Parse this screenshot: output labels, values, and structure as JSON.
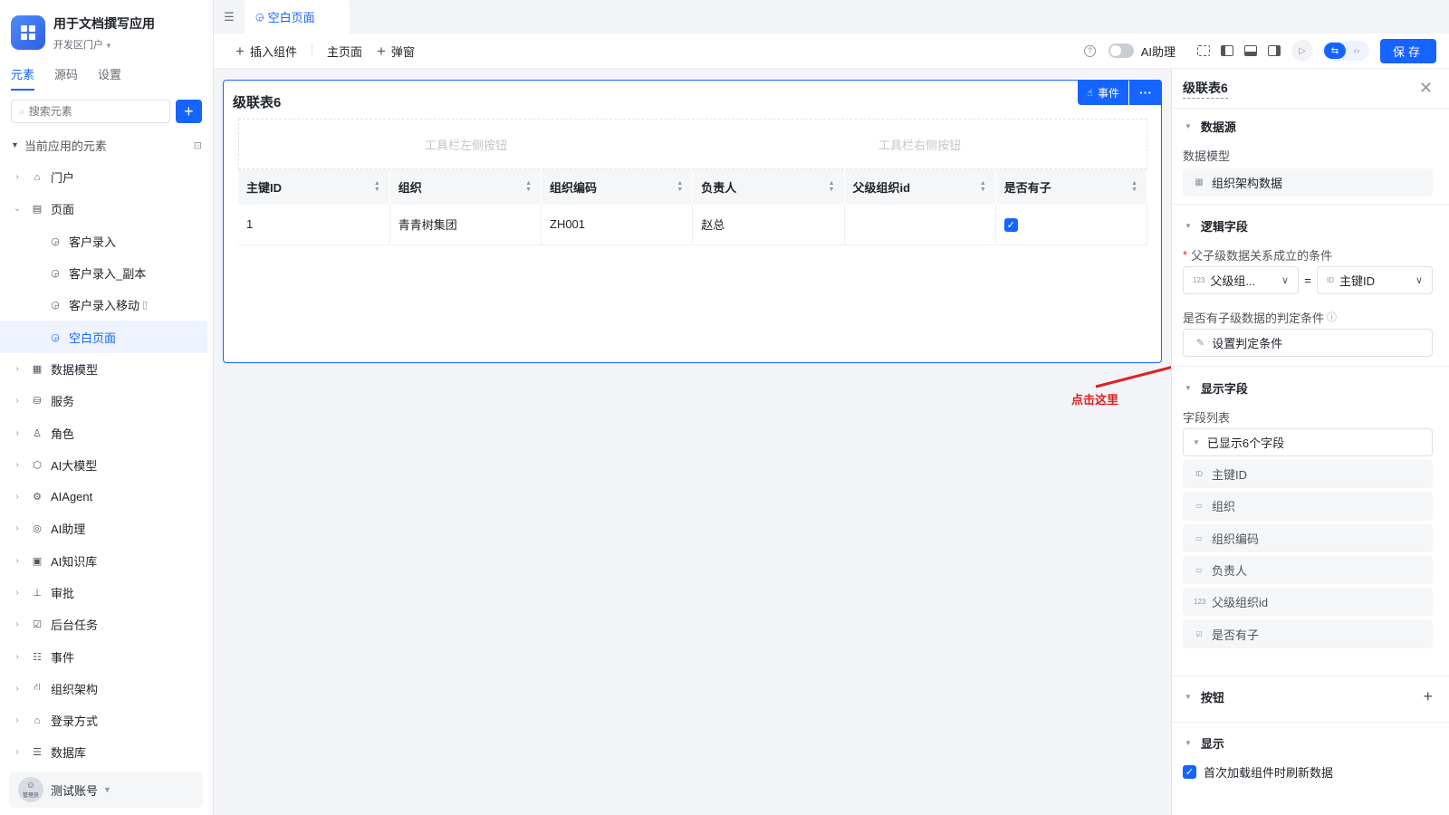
{
  "app": {
    "title": "用于文档撰写应用",
    "subtitle": "开发区门户"
  },
  "sidebar": {
    "tabs": [
      "元素",
      "源码",
      "设置"
    ],
    "search_placeholder": "搜索元素",
    "section_title": "当前应用的元素",
    "items": [
      {
        "label": "门户",
        "icon": "home-icon"
      },
      {
        "label": "页面",
        "icon": "page-icon"
      },
      {
        "label": "客户录入",
        "icon": "page-link-icon"
      },
      {
        "label": "客户录入_副本",
        "icon": "page-link-icon"
      },
      {
        "label": "客户录入移动",
        "icon": "page-link-icon"
      },
      {
        "label": "空白页面",
        "icon": "page-link-icon"
      },
      {
        "label": "数据模型",
        "icon": "table-icon"
      },
      {
        "label": "服务",
        "icon": "service-icon"
      },
      {
        "label": "角色",
        "icon": "role-icon"
      },
      {
        "label": "AI大模型",
        "icon": "ai-model-icon"
      },
      {
        "label": "AIAgent",
        "icon": "robot-icon"
      },
      {
        "label": "AI助理",
        "icon": "ai-assistant-icon"
      },
      {
        "label": "AI知识库",
        "icon": "knowledge-base-icon"
      },
      {
        "label": "审批",
        "icon": "stamp-icon"
      },
      {
        "label": "后台任务",
        "icon": "task-icon"
      },
      {
        "label": "事件",
        "icon": "event-icon"
      },
      {
        "label": "组织架构",
        "icon": "org-icon"
      },
      {
        "label": "登录方式",
        "icon": "login-icon"
      },
      {
        "label": "数据库",
        "icon": "database-icon"
      }
    ],
    "user": {
      "name": "测试账号",
      "avatar_text": "管理员"
    }
  },
  "tabbar": {
    "active_tab": "空白页面"
  },
  "toolbar": {
    "insert_component": "插入组件",
    "main_page": "主页面",
    "popup": "弹窗",
    "ai_assistant": "AI助理",
    "save": "保存"
  },
  "widget": {
    "title": "级联表6",
    "event_button": "事件",
    "toolbar_left": "工具栏左侧按钮",
    "toolbar_right": "工具栏右侧按钮",
    "columns": [
      "主键ID",
      "组织",
      "组织编码",
      "负责人",
      "父级组织id",
      "是否有子"
    ],
    "rows": [
      {
        "id": "1",
        "org": "青青树集团",
        "code": "ZH001",
        "owner": "赵总",
        "parent": "",
        "has_child": true
      }
    ]
  },
  "annotation": {
    "text": "点击这里",
    "color": "#e02020"
  },
  "panel": {
    "title": "级联表6",
    "datasource_section": "数据源",
    "data_model_label": "数据模型",
    "data_model_value": "组织架构数据",
    "logic_section": "逻辑字段",
    "condition_label": "父子级数据关系成立的条件",
    "condition_left": "父级组...",
    "condition_op": "=",
    "condition_right": "主键ID",
    "has_child_label": "是否有子级数据的判定条件",
    "set_condition": "设置判定条件",
    "display_section": "显示字段",
    "field_list_label": "字段列表",
    "fields_shown": "已显示6个字段",
    "fields": [
      {
        "label": "主键ID",
        "icon": "id-icon"
      },
      {
        "label": "组织",
        "icon": "text-field-icon"
      },
      {
        "label": "组织编码",
        "icon": "text-field-icon"
      },
      {
        "label": "负责人",
        "icon": "text-field-icon"
      },
      {
        "label": "父级组织id",
        "icon": "number-field-icon"
      },
      {
        "label": "是否有子",
        "icon": "checkbox-field-icon"
      }
    ],
    "buttons_section": "按钮",
    "show_section": "显示",
    "reload_on_first_load": "首次加载组件时刷新数据"
  },
  "colors": {
    "accent": "#1664ff",
    "annotation_red": "#e02020"
  }
}
